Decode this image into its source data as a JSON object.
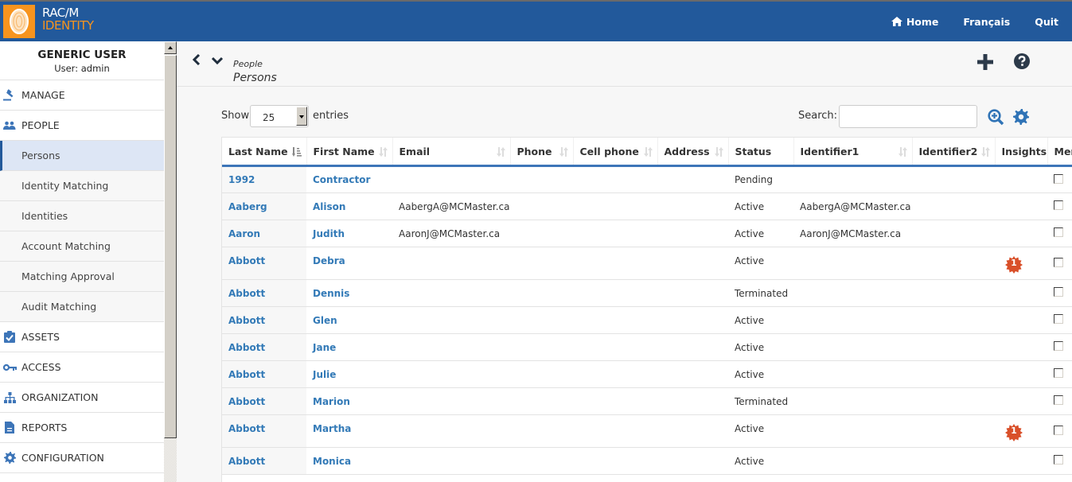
{
  "app": {
    "logo_line1": "RAC/M",
    "logo_line2": "IDENTITY",
    "colors": {
      "brand": "#22599b",
      "accent": "#f7941e",
      "link": "#337ab7",
      "badge": "#d9502a"
    }
  },
  "topnav": {
    "home": "Home",
    "language": "Français",
    "quit": "Quit"
  },
  "sidebar": {
    "user_name": "GENERIC USER",
    "user_sub": "User: admin",
    "items": [
      {
        "label": "MANAGE",
        "icon": "gavel-icon"
      },
      {
        "label": "PEOPLE",
        "icon": "users-icon"
      },
      {
        "label": "ASSETS",
        "icon": "clipboard-check-icon"
      },
      {
        "label": "ACCESS",
        "icon": "key-icon"
      },
      {
        "label": "ORGANIZATION",
        "icon": "sitemap-icon"
      },
      {
        "label": "REPORTS",
        "icon": "file-icon"
      },
      {
        "label": "CONFIGURATION",
        "icon": "gear-icon"
      }
    ],
    "people_sub": [
      {
        "label": "Persons",
        "active": true
      },
      {
        "label": "Identity Matching"
      },
      {
        "label": "Identities"
      },
      {
        "label": "Account Matching"
      },
      {
        "label": "Matching Approval"
      },
      {
        "label": "Audit Matching"
      }
    ]
  },
  "header": {
    "breadcrumb_parent": "People",
    "title": "Persons"
  },
  "controls": {
    "show_label": "Show",
    "page_size": "25",
    "entries_label": "entries",
    "search_label": "Search:",
    "search_value": ""
  },
  "table": {
    "columns": [
      "Last Name",
      "First Name",
      "Email",
      "Phone",
      "Cell phone",
      "Address",
      "Status",
      "Identifier1",
      "Identifier2",
      "Insights",
      "Merge"
    ],
    "rows": [
      {
        "last": "1992",
        "first": "Contractor",
        "email": "",
        "status": "Pending",
        "id1": "",
        "insight": ""
      },
      {
        "last": "Aaberg",
        "first": "Alison",
        "email": "AabergA@MCMaster.ca",
        "status": "Active",
        "id1": "AabergA@MCMaster.ca",
        "insight": ""
      },
      {
        "last": "Aaron",
        "first": "Judith",
        "email": "AaronJ@MCMaster.ca",
        "status": "Active",
        "id1": "AaronJ@MCMaster.ca",
        "insight": ""
      },
      {
        "last": "Abbott",
        "first": "Debra",
        "email": "",
        "status": "Active",
        "id1": "",
        "insight": "1"
      },
      {
        "last": "Abbott",
        "first": "Dennis",
        "email": "",
        "status": "Terminated",
        "id1": "",
        "insight": ""
      },
      {
        "last": "Abbott",
        "first": "Glen",
        "email": "",
        "status": "Active",
        "id1": "",
        "insight": ""
      },
      {
        "last": "Abbott",
        "first": "Jane",
        "email": "",
        "status": "Active",
        "id1": "",
        "insight": ""
      },
      {
        "last": "Abbott",
        "first": "Julie",
        "email": "",
        "status": "Active",
        "id1": "",
        "insight": ""
      },
      {
        "last": "Abbott",
        "first": "Marion",
        "email": "",
        "status": "Terminated",
        "id1": "",
        "insight": ""
      },
      {
        "last": "Abbott",
        "first": "Martha",
        "email": "",
        "status": "Active",
        "id1": "",
        "insight": "1"
      },
      {
        "last": "Abbott",
        "first": "Monica",
        "email": "",
        "status": "Active",
        "id1": "",
        "insight": ""
      }
    ]
  }
}
